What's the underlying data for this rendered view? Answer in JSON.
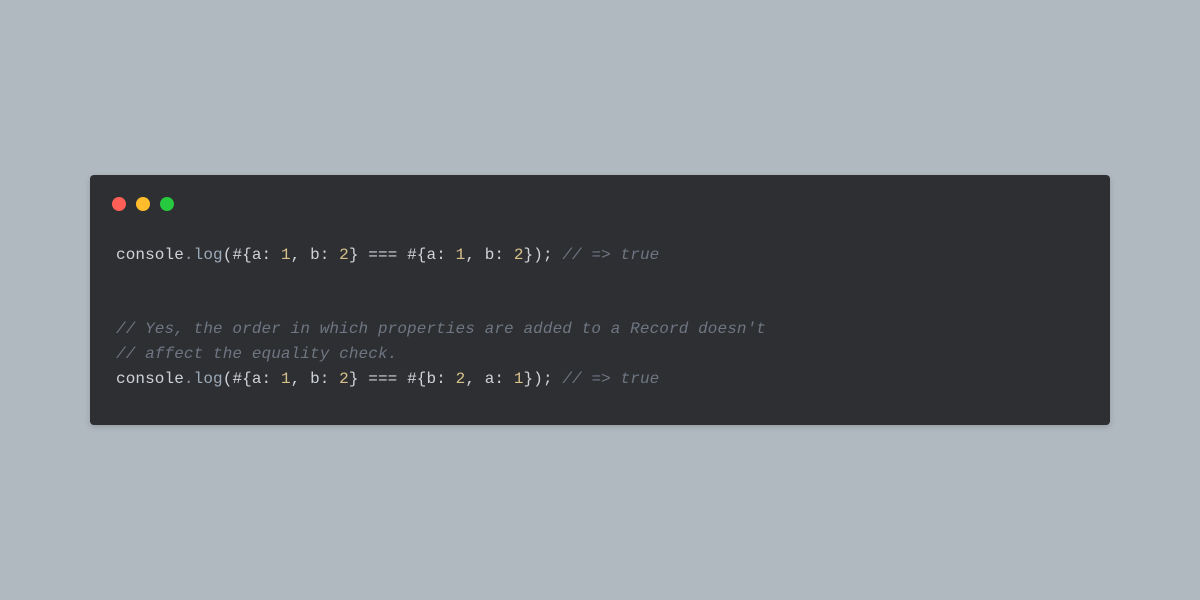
{
  "traffic_lights": {
    "red": "#ff5f56",
    "yellow": "#ffbd2e",
    "green": "#27c93f"
  },
  "code": {
    "lines": [
      {
        "tokens": [
          {
            "cls": "tok-obj",
            "t": "console"
          },
          {
            "cls": "tok-dot",
            "t": "."
          },
          {
            "cls": "tok-fn",
            "t": "log"
          },
          {
            "cls": "tok-paren",
            "t": "("
          },
          {
            "cls": "tok-hash",
            "t": "#"
          },
          {
            "cls": "tok-brace",
            "t": "{"
          },
          {
            "cls": "tok-key",
            "t": "a"
          },
          {
            "cls": "tok-colon",
            "t": ": "
          },
          {
            "cls": "tok-num",
            "t": "1"
          },
          {
            "cls": "tok-punct",
            "t": ", "
          },
          {
            "cls": "tok-key",
            "t": "b"
          },
          {
            "cls": "tok-colon",
            "t": ": "
          },
          {
            "cls": "tok-num",
            "t": "2"
          },
          {
            "cls": "tok-brace",
            "t": "}"
          },
          {
            "cls": "tok-op",
            "t": " === "
          },
          {
            "cls": "tok-hash",
            "t": "#"
          },
          {
            "cls": "tok-brace",
            "t": "{"
          },
          {
            "cls": "tok-key",
            "t": "a"
          },
          {
            "cls": "tok-colon",
            "t": ": "
          },
          {
            "cls": "tok-num",
            "t": "1"
          },
          {
            "cls": "tok-punct",
            "t": ", "
          },
          {
            "cls": "tok-key",
            "t": "b"
          },
          {
            "cls": "tok-colon",
            "t": ": "
          },
          {
            "cls": "tok-num",
            "t": "2"
          },
          {
            "cls": "tok-brace",
            "t": "}"
          },
          {
            "cls": "tok-paren",
            "t": ")"
          },
          {
            "cls": "tok-punct",
            "t": "; "
          },
          {
            "cls": "tok-comment",
            "t": "// => true"
          }
        ]
      },
      {
        "tokens": [
          {
            "cls": "",
            "t": " "
          }
        ]
      },
      {
        "tokens": [
          {
            "cls": "",
            "t": " "
          }
        ]
      },
      {
        "tokens": [
          {
            "cls": "tok-comment",
            "t": "// Yes, the order in which properties are added to a Record doesn't"
          }
        ]
      },
      {
        "tokens": [
          {
            "cls": "tok-comment",
            "t": "// affect the equality check."
          }
        ]
      },
      {
        "tokens": [
          {
            "cls": "tok-obj",
            "t": "console"
          },
          {
            "cls": "tok-dot",
            "t": "."
          },
          {
            "cls": "tok-fn",
            "t": "log"
          },
          {
            "cls": "tok-paren",
            "t": "("
          },
          {
            "cls": "tok-hash",
            "t": "#"
          },
          {
            "cls": "tok-brace",
            "t": "{"
          },
          {
            "cls": "tok-key",
            "t": "a"
          },
          {
            "cls": "tok-colon",
            "t": ": "
          },
          {
            "cls": "tok-num",
            "t": "1"
          },
          {
            "cls": "tok-punct",
            "t": ", "
          },
          {
            "cls": "tok-key",
            "t": "b"
          },
          {
            "cls": "tok-colon",
            "t": ": "
          },
          {
            "cls": "tok-num",
            "t": "2"
          },
          {
            "cls": "tok-brace",
            "t": "}"
          },
          {
            "cls": "tok-op",
            "t": " === "
          },
          {
            "cls": "tok-hash",
            "t": "#"
          },
          {
            "cls": "tok-brace",
            "t": "{"
          },
          {
            "cls": "tok-key",
            "t": "b"
          },
          {
            "cls": "tok-colon",
            "t": ": "
          },
          {
            "cls": "tok-num",
            "t": "2"
          },
          {
            "cls": "tok-punct",
            "t": ", "
          },
          {
            "cls": "tok-key",
            "t": "a"
          },
          {
            "cls": "tok-colon",
            "t": ": "
          },
          {
            "cls": "tok-num",
            "t": "1"
          },
          {
            "cls": "tok-brace",
            "t": "}"
          },
          {
            "cls": "tok-paren",
            "t": ")"
          },
          {
            "cls": "tok-punct",
            "t": "; "
          },
          {
            "cls": "tok-comment",
            "t": "// => true"
          }
        ]
      }
    ]
  }
}
